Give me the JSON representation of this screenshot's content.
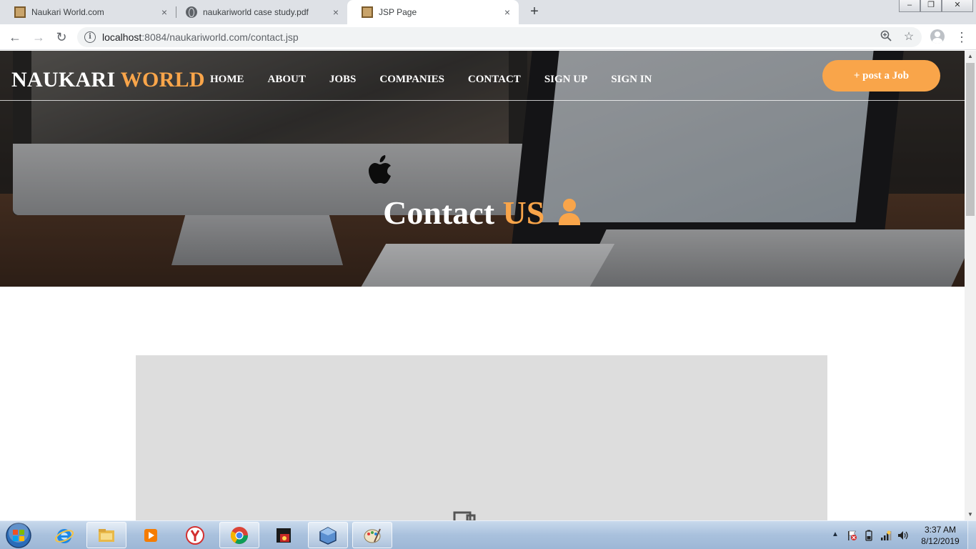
{
  "browser": {
    "tabs": [
      {
        "title": "Naukari World.com",
        "icon": "image-favicon",
        "active": false
      },
      {
        "title": "naukariworld case study.pdf",
        "icon": "globe-favicon",
        "active": false
      },
      {
        "title": "JSP Page",
        "icon": "image-favicon",
        "active": true
      }
    ],
    "close_glyph": "×",
    "new_tab_glyph": "+",
    "url_host": "localhost",
    "url_path": ":8084/naukariworld.com/contact.jsp",
    "window_controls": {
      "minimize": "–",
      "maximize": "❐",
      "close": "✕"
    }
  },
  "site": {
    "brand_primary": "NAUKARI",
    "brand_accent": "WORLD",
    "nav": [
      "HOME",
      "ABOUT",
      "JOBS",
      "COMPANIES",
      "CONTACT",
      "SIGN UP",
      "SIGN IN"
    ],
    "post_job_label": "+ post a Job",
    "hero_title_primary": "Contact",
    "hero_title_accent": "US",
    "accent_color": "#f9a54a"
  },
  "taskbar": {
    "apps": [
      "internet-explorer",
      "windows-explorer",
      "media-player",
      "yandex-browser",
      "chrome",
      "ms-access",
      "virtualbox",
      "paint"
    ],
    "clock_time": "3:37 AM",
    "clock_date": "8/12/2019"
  }
}
